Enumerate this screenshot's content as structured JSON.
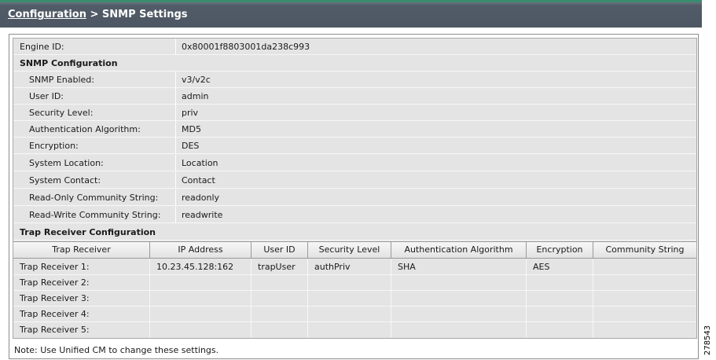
{
  "header": {
    "breadcrumb_link": "Configuration",
    "breadcrumb_sep": " > ",
    "title": "SNMP Settings"
  },
  "engine": {
    "label": "Engine ID:",
    "value": "0x80001f8803001da238c993"
  },
  "snmp_config": {
    "heading": "SNMP Configuration",
    "rows": [
      {
        "label": "SNMP Enabled:",
        "value": "v3/v2c"
      },
      {
        "label": "User ID:",
        "value": "admin"
      },
      {
        "label": "Security Level:",
        "value": "priv"
      },
      {
        "label": "Authentication Algorithm:",
        "value": "MD5"
      },
      {
        "label": "Encryption:",
        "value": "DES"
      },
      {
        "label": "System Location:",
        "value": "Location"
      },
      {
        "label": "System Contact:",
        "value": "Contact"
      },
      {
        "label": "Read-Only Community String:",
        "value": "readonly"
      },
      {
        "label": "Read-Write Community String:",
        "value": "readwrite"
      }
    ]
  },
  "trap": {
    "heading": "Trap Receiver Configuration",
    "columns": [
      "Trap Receiver",
      "IP Address",
      "User ID",
      "Security Level",
      "Authentication Algorithm",
      "Encryption",
      "Community String"
    ],
    "rows": [
      [
        "Trap Receiver 1:",
        "10.23.45.128:162",
        "trapUser",
        "authPriv",
        "SHA",
        "AES",
        ""
      ],
      [
        "Trap Receiver 2:",
        "",
        "",
        "",
        "",
        "",
        ""
      ],
      [
        "Trap Receiver 3:",
        "",
        "",
        "",
        "",
        "",
        ""
      ],
      [
        "Trap Receiver 4:",
        "",
        "",
        "",
        "",
        "",
        ""
      ],
      [
        "Trap Receiver 5:",
        "",
        "",
        "",
        "",
        "",
        ""
      ]
    ]
  },
  "note": "Note: Use Unified CM to change these settings.",
  "figure_number": "278543"
}
